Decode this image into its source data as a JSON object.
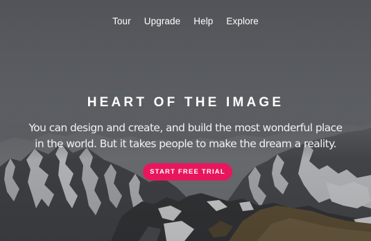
{
  "nav": {
    "items": [
      {
        "label": "Tour"
      },
      {
        "label": "Upgrade"
      },
      {
        "label": "Help"
      },
      {
        "label": "Explore"
      }
    ]
  },
  "hero": {
    "title": "HEART OF THE IMAGE",
    "subtitle": "You can design and create, and build the most wonderful place in the world. But it takes people to make the dream a reality.",
    "cta_label": "START FREE TRIAL"
  },
  "colors": {
    "accent": "#e8175d",
    "sky": "#5e6166",
    "text": "#ffffff"
  }
}
